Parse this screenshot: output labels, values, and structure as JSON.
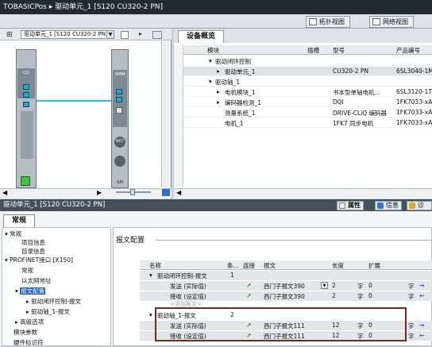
{
  "window": {
    "title": "TOBASICPos ▸ 驱动单元_1 [S120 CU320-2 PN]"
  },
  "views": {
    "topology": "拓扑视图",
    "network": "网络视图"
  },
  "device_selector": {
    "value": "驱动单元_1 [S120 CU320-2 PN]"
  },
  "graphic": {
    "cu_label": "CU",
    "smm_label": "SMM",
    "mot_label": "MOT",
    "sm_label": "SM"
  },
  "overview": {
    "tab": "设备概览",
    "columns": {
      "module": "模块",
      "slot": "插槽",
      "type": "型号",
      "order": "产品编号"
    },
    "rows": [
      {
        "name": "驱动闭环控制",
        "slot": "",
        "type": "",
        "order": ""
      },
      {
        "name": "驱动单元_1",
        "slot": "",
        "type": "CU320-2 PN",
        "order": "6SL3040-1M"
      },
      {
        "name": "驱动轴_1",
        "slot": "",
        "type": "",
        "order": ""
      },
      {
        "name": "电机模块_1",
        "slot": "",
        "type": "书本型单轴电机...",
        "order": "6SL3120-1TE"
      },
      {
        "name": "编码器检测_1",
        "slot": "",
        "type": "DQI",
        "order": "1FK7033-xAF"
      },
      {
        "name": "测量系统_1",
        "slot": "",
        "type": "DRIVE-CLiQ 编码器",
        "order": "1FK7033-xAF"
      },
      {
        "name": "电机_1",
        "slot": "",
        "type": "1FK7 同步电机",
        "order": "1FK7033-xAF"
      }
    ]
  },
  "properties": {
    "title": "驱动单元_1 [S120 CU320-2 PN]",
    "tabs": {
      "properties": "属性",
      "info": "信息",
      "diag": "诊"
    },
    "general_tab": "常规"
  },
  "nav": [
    {
      "label": "常规"
    },
    {
      "label": "项目信息"
    },
    {
      "label": "目录信息"
    },
    {
      "label": "PROFINET接口 [X150]"
    },
    {
      "label": "常规"
    },
    {
      "label": "以太网地址"
    },
    {
      "label": "报文配置"
    },
    {
      "label": "驱动闭环控制-报文"
    },
    {
      "label": "驱动轴_1-报文"
    },
    {
      "label": "高级选项"
    },
    {
      "label": "模块参数"
    },
    {
      "label": "硬件标识符"
    }
  ],
  "telegram": {
    "section": "报文配置",
    "columns": {
      "name": "名称",
      "item": "条...",
      "conn": "连接",
      "tel": "报文",
      "len": "长度",
      "ext": "扩展"
    },
    "rows": [
      {
        "name": "驱动闭环控制-报文",
        "item": "1",
        "tel": "",
        "len": "",
        "unit": "",
        "ext": "",
        "unit2": ""
      },
      {
        "name": "发送 (实际值)",
        "item": "",
        "tel": "西门子报文390",
        "len": "2",
        "unit": "字",
        "ext": "0",
        "unit2": "字"
      },
      {
        "name": "接收 (设定值)",
        "item": "",
        "tel": "西门子报文390",
        "len": "2",
        "unit": "字",
        "ext": "0",
        "unit2": "字"
      },
      {
        "name": "<添加报文>",
        "item": "",
        "tel": "",
        "len": "",
        "unit": "",
        "ext": "",
        "unit2": ""
      },
      {
        "name": "驱动轴_1-报文",
        "item": "2",
        "tel": "",
        "len": "",
        "unit": "",
        "ext": "",
        "unit2": ""
      },
      {
        "name": "发送 (实际值)",
        "item": "",
        "tel": "西门子报文111",
        "len": "12",
        "unit": "字",
        "ext": "0",
        "unit2": "字"
      },
      {
        "name": "接收 (设定值)",
        "item": "",
        "tel": "西门子报文111",
        "len": "12",
        "unit": "字",
        "ext": "0",
        "unit2": "字"
      }
    ]
  }
}
